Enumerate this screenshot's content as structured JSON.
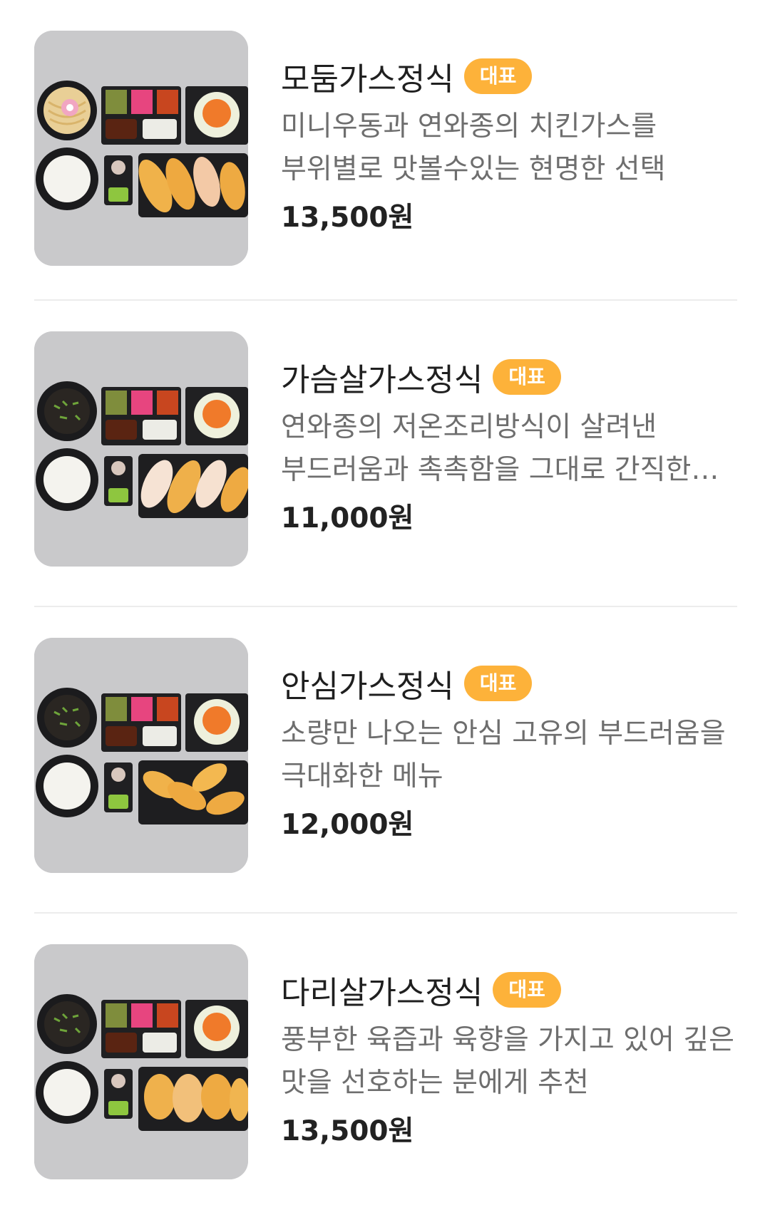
{
  "menu": {
    "items": [
      {
        "name": "모둠가스정식",
        "badge": "대표",
        "description": "미니우동과 연와종의 치킨가스를 부위별로 맛볼수있는 현명한 선택",
        "price": "13,500원",
        "image_icon": "set-meal-photo-udon"
      },
      {
        "name": "가슴살가스정식",
        "badge": "대표",
        "description": "연와종의 저온조리방식이 살려낸 부드러움과 촉촉함을 그대로 간직한 연와…",
        "price": "11,000원",
        "image_icon": "set-meal-photo-soup"
      },
      {
        "name": "안심가스정식",
        "badge": "대표",
        "description": "소량만 나오는 안심 고유의 부드러움을 극대화한 메뉴",
        "price": "12,000원",
        "image_icon": "set-meal-photo-soup"
      },
      {
        "name": "다리살가스정식",
        "badge": "대표",
        "description": "풍부한 육즙과 육향을 가지고 있어 깊은 맛을 선호하는 분에게 추천",
        "price": "13,500원",
        "image_icon": "set-meal-photo-soup"
      }
    ]
  },
  "colors": {
    "badge_bg": "#fdb23a",
    "badge_text": "#ffffff",
    "description": "#6e6e6e",
    "photo_bg": "#c9c9cb"
  }
}
